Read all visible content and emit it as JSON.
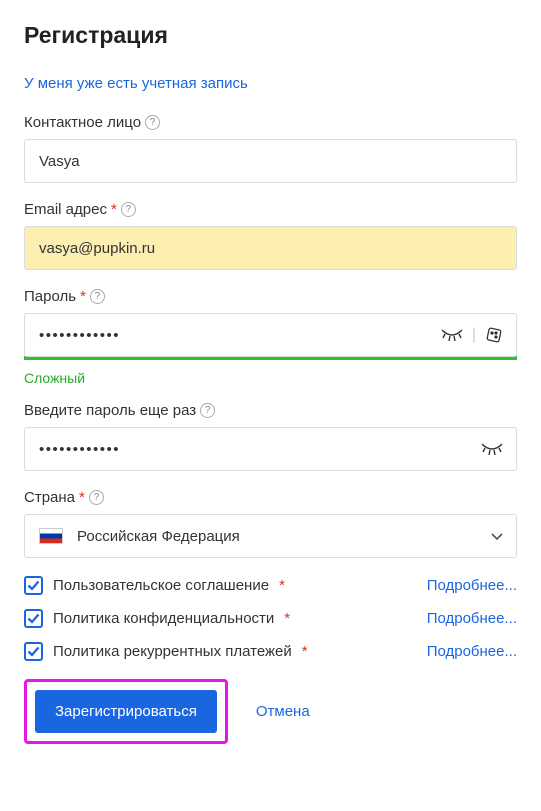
{
  "title": "Регистрация",
  "login_link": "У меня уже есть учетная запись",
  "fields": {
    "contact": {
      "label": "Контактное лицо",
      "value": "Vasya",
      "required": false
    },
    "email": {
      "label": "Email адрес",
      "value": "vasya@pupkin.ru",
      "required": true
    },
    "password": {
      "label": "Пароль",
      "value": "••••••••••••",
      "required": true,
      "strength_label": "Сложный"
    },
    "password_repeat": {
      "label": "Введите пароль еще раз",
      "value": "••••••••••••",
      "required": false
    },
    "country": {
      "label": "Страна",
      "required": true,
      "selected": "Российская Федерация"
    }
  },
  "agreements": [
    {
      "text": "Пользовательское соглашение",
      "checked": true,
      "more": "Подробнее..."
    },
    {
      "text": "Политика конфиденциальности",
      "checked": true,
      "more": "Подробнее..."
    },
    {
      "text": "Политика рекуррентных платежей",
      "checked": true,
      "more": "Подробнее..."
    }
  ],
  "buttons": {
    "register": "Зарегистрироваться",
    "cancel": "Отмена"
  }
}
